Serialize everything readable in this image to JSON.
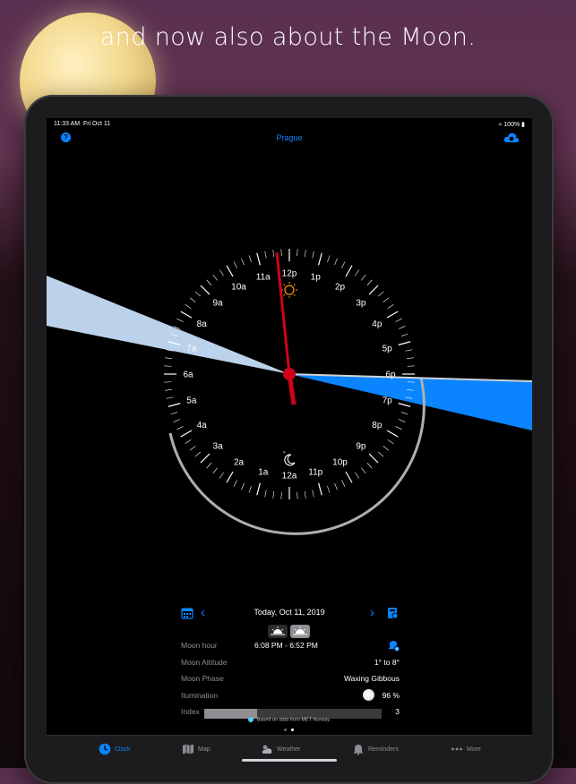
{
  "promo": {
    "headline": "and now also about the Moon."
  },
  "status_bar": {
    "time": "11:33 AM",
    "date": "Fri Oct 11",
    "battery": "100%"
  },
  "nav": {
    "title": "Prague",
    "help_icon": "question-icon",
    "cloud_icon": "cloud-icon"
  },
  "clock": {
    "hour_labels": [
      "12p",
      "1p",
      "2p",
      "3p",
      "4p",
      "5p",
      "6p",
      "7p",
      "8p",
      "9p",
      "10p",
      "11p",
      "12a",
      "1a",
      "2a",
      "3a",
      "4a",
      "5a",
      "6a",
      "7a",
      "8a",
      "9a",
      "10a",
      "11a"
    ],
    "sun_icon": "sun-icon",
    "moon_icon": "moon-icon",
    "colors": {
      "day_wedge": "#bcd1ea",
      "night_wedge": "#0a84ff",
      "hand": "#d0021b",
      "ring": "#aeaeb2"
    }
  },
  "controls": {
    "date": "Today, Oct 11, 2019",
    "calendar_icon": "calendar-icon"
  },
  "info": {
    "moon_hour": {
      "label": "Moon hour",
      "value": "6:08 PM - 6:52 PM"
    },
    "moon_altitude": {
      "label": "Moon Altitude",
      "value": "1° to 8°"
    },
    "moon_phase": {
      "label": "Moon Phase",
      "value": "Waxing Gibbous"
    },
    "illumination": {
      "label": "Ilumination",
      "value": "96 %"
    },
    "index": {
      "label": "Index",
      "value": "3",
      "fill_fraction": 0.3
    }
  },
  "note": "Based on data from MET Norway.",
  "tabs": [
    {
      "label": "Clock",
      "icon": "clock-icon"
    },
    {
      "label": "Map",
      "icon": "map-icon"
    },
    {
      "label": "Weather",
      "icon": "weather-icon"
    },
    {
      "label": "Reminders",
      "icon": "bell-icon"
    },
    {
      "label": "More",
      "icon": "more-icon"
    }
  ]
}
